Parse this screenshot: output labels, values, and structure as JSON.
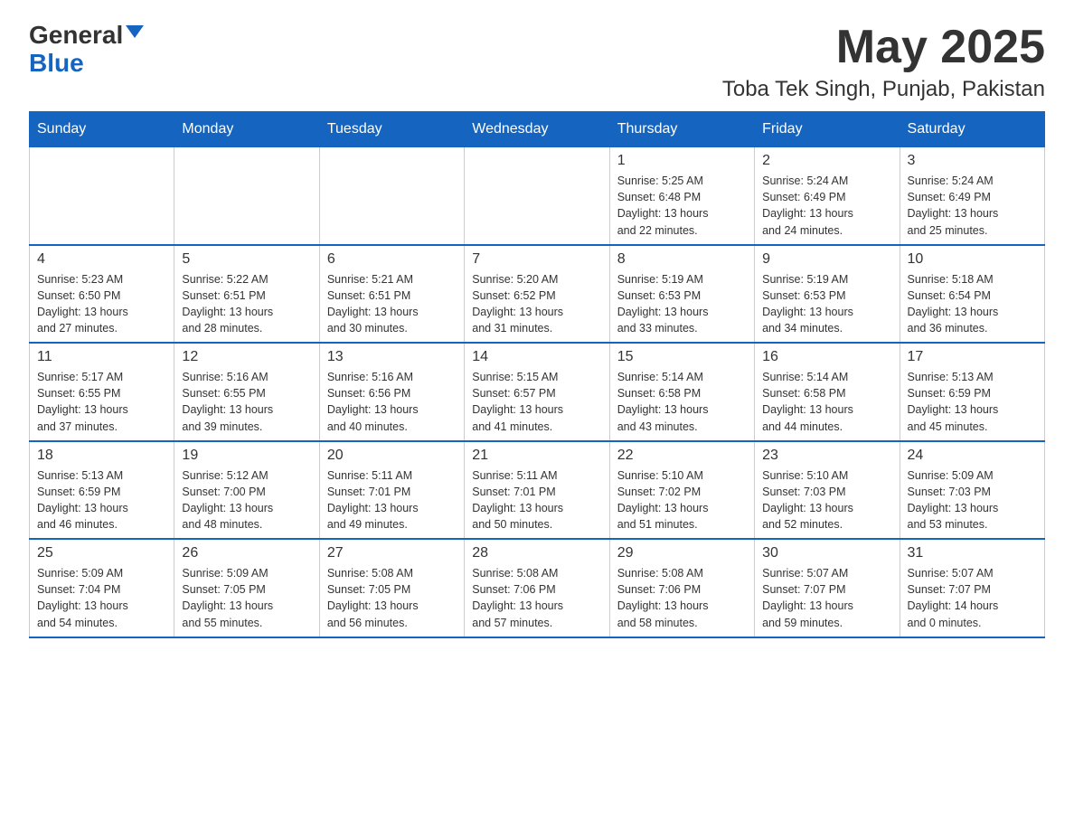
{
  "header": {
    "logo_general": "General",
    "logo_blue": "Blue",
    "title": "May 2025",
    "subtitle": "Toba Tek Singh, Punjab, Pakistan"
  },
  "calendar": {
    "days_of_week": [
      "Sunday",
      "Monday",
      "Tuesday",
      "Wednesday",
      "Thursday",
      "Friday",
      "Saturday"
    ],
    "weeks": [
      [
        {
          "day": "",
          "info": ""
        },
        {
          "day": "",
          "info": ""
        },
        {
          "day": "",
          "info": ""
        },
        {
          "day": "",
          "info": ""
        },
        {
          "day": "1",
          "info": "Sunrise: 5:25 AM\nSunset: 6:48 PM\nDaylight: 13 hours\nand 22 minutes."
        },
        {
          "day": "2",
          "info": "Sunrise: 5:24 AM\nSunset: 6:49 PM\nDaylight: 13 hours\nand 24 minutes."
        },
        {
          "day": "3",
          "info": "Sunrise: 5:24 AM\nSunset: 6:49 PM\nDaylight: 13 hours\nand 25 minutes."
        }
      ],
      [
        {
          "day": "4",
          "info": "Sunrise: 5:23 AM\nSunset: 6:50 PM\nDaylight: 13 hours\nand 27 minutes."
        },
        {
          "day": "5",
          "info": "Sunrise: 5:22 AM\nSunset: 6:51 PM\nDaylight: 13 hours\nand 28 minutes."
        },
        {
          "day": "6",
          "info": "Sunrise: 5:21 AM\nSunset: 6:51 PM\nDaylight: 13 hours\nand 30 minutes."
        },
        {
          "day": "7",
          "info": "Sunrise: 5:20 AM\nSunset: 6:52 PM\nDaylight: 13 hours\nand 31 minutes."
        },
        {
          "day": "8",
          "info": "Sunrise: 5:19 AM\nSunset: 6:53 PM\nDaylight: 13 hours\nand 33 minutes."
        },
        {
          "day": "9",
          "info": "Sunrise: 5:19 AM\nSunset: 6:53 PM\nDaylight: 13 hours\nand 34 minutes."
        },
        {
          "day": "10",
          "info": "Sunrise: 5:18 AM\nSunset: 6:54 PM\nDaylight: 13 hours\nand 36 minutes."
        }
      ],
      [
        {
          "day": "11",
          "info": "Sunrise: 5:17 AM\nSunset: 6:55 PM\nDaylight: 13 hours\nand 37 minutes."
        },
        {
          "day": "12",
          "info": "Sunrise: 5:16 AM\nSunset: 6:55 PM\nDaylight: 13 hours\nand 39 minutes."
        },
        {
          "day": "13",
          "info": "Sunrise: 5:16 AM\nSunset: 6:56 PM\nDaylight: 13 hours\nand 40 minutes."
        },
        {
          "day": "14",
          "info": "Sunrise: 5:15 AM\nSunset: 6:57 PM\nDaylight: 13 hours\nand 41 minutes."
        },
        {
          "day": "15",
          "info": "Sunrise: 5:14 AM\nSunset: 6:58 PM\nDaylight: 13 hours\nand 43 minutes."
        },
        {
          "day": "16",
          "info": "Sunrise: 5:14 AM\nSunset: 6:58 PM\nDaylight: 13 hours\nand 44 minutes."
        },
        {
          "day": "17",
          "info": "Sunrise: 5:13 AM\nSunset: 6:59 PM\nDaylight: 13 hours\nand 45 minutes."
        }
      ],
      [
        {
          "day": "18",
          "info": "Sunrise: 5:13 AM\nSunset: 6:59 PM\nDaylight: 13 hours\nand 46 minutes."
        },
        {
          "day": "19",
          "info": "Sunrise: 5:12 AM\nSunset: 7:00 PM\nDaylight: 13 hours\nand 48 minutes."
        },
        {
          "day": "20",
          "info": "Sunrise: 5:11 AM\nSunset: 7:01 PM\nDaylight: 13 hours\nand 49 minutes."
        },
        {
          "day": "21",
          "info": "Sunrise: 5:11 AM\nSunset: 7:01 PM\nDaylight: 13 hours\nand 50 minutes."
        },
        {
          "day": "22",
          "info": "Sunrise: 5:10 AM\nSunset: 7:02 PM\nDaylight: 13 hours\nand 51 minutes."
        },
        {
          "day": "23",
          "info": "Sunrise: 5:10 AM\nSunset: 7:03 PM\nDaylight: 13 hours\nand 52 minutes."
        },
        {
          "day": "24",
          "info": "Sunrise: 5:09 AM\nSunset: 7:03 PM\nDaylight: 13 hours\nand 53 minutes."
        }
      ],
      [
        {
          "day": "25",
          "info": "Sunrise: 5:09 AM\nSunset: 7:04 PM\nDaylight: 13 hours\nand 54 minutes."
        },
        {
          "day": "26",
          "info": "Sunrise: 5:09 AM\nSunset: 7:05 PM\nDaylight: 13 hours\nand 55 minutes."
        },
        {
          "day": "27",
          "info": "Sunrise: 5:08 AM\nSunset: 7:05 PM\nDaylight: 13 hours\nand 56 minutes."
        },
        {
          "day": "28",
          "info": "Sunrise: 5:08 AM\nSunset: 7:06 PM\nDaylight: 13 hours\nand 57 minutes."
        },
        {
          "day": "29",
          "info": "Sunrise: 5:08 AM\nSunset: 7:06 PM\nDaylight: 13 hours\nand 58 minutes."
        },
        {
          "day": "30",
          "info": "Sunrise: 5:07 AM\nSunset: 7:07 PM\nDaylight: 13 hours\nand 59 minutes."
        },
        {
          "day": "31",
          "info": "Sunrise: 5:07 AM\nSunset: 7:07 PM\nDaylight: 14 hours\nand 0 minutes."
        }
      ]
    ]
  }
}
